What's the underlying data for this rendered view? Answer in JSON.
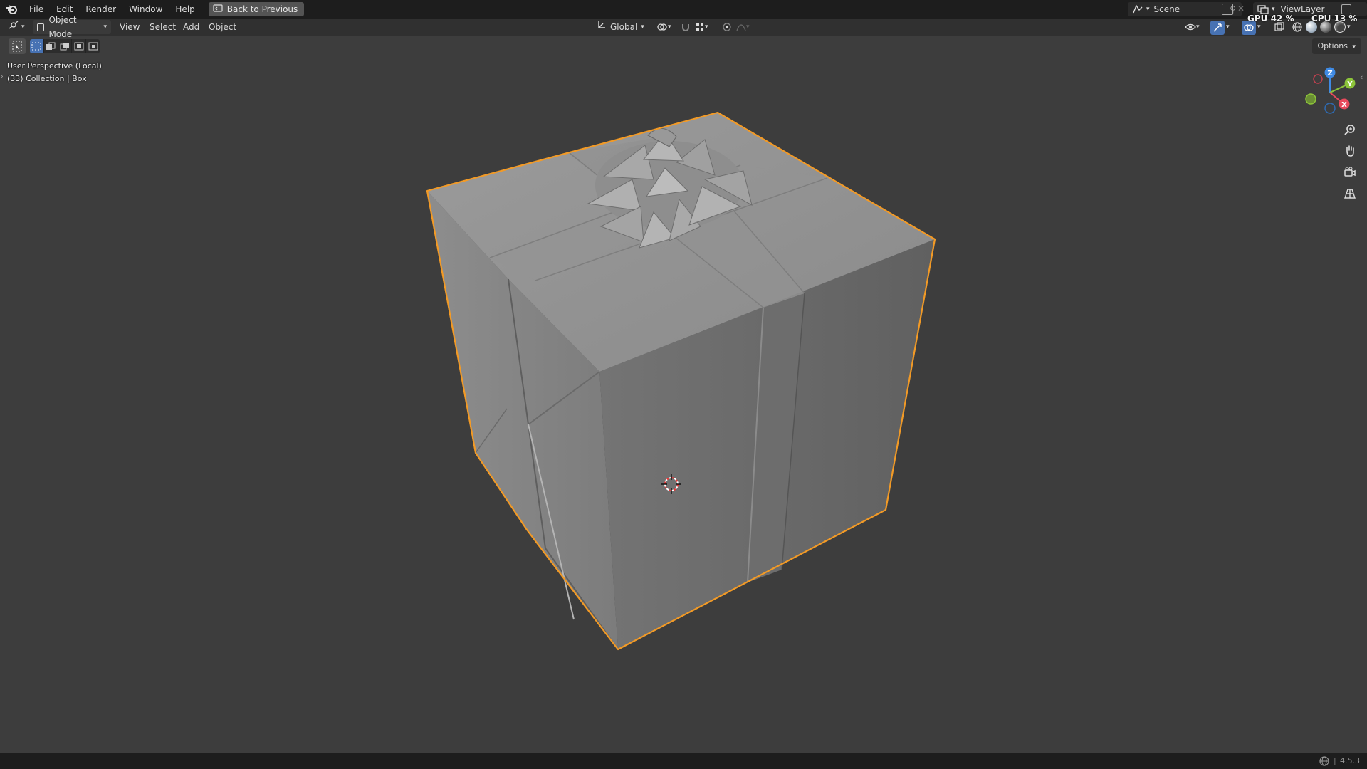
{
  "topbar": {
    "menus": [
      "File",
      "Edit",
      "Render",
      "Window",
      "Help"
    ],
    "back_button": "Back to Previous",
    "scene": "Scene",
    "view_layer": "ViewLayer",
    "gpu": "GPU 42 %",
    "cpu": "CPU 13 %"
  },
  "viewport_header": {
    "mode": "Object Mode",
    "menus": [
      "View",
      "Select",
      "Add",
      "Object"
    ],
    "orientation": "Global"
  },
  "options_label": "Options",
  "overlay": {
    "perspective": "User Perspective (Local)",
    "collection": "(33) Collection | Box"
  },
  "gizmo": {
    "x": "X",
    "y": "Y",
    "z": "Z"
  },
  "status": {
    "version": "4.5.3"
  },
  "colors": {
    "accent": "#4772b3",
    "selection_outline": "#f29a26",
    "axis_x": "#e94a5c",
    "axis_y": "#8cc43a",
    "axis_z": "#3f8ae3"
  }
}
